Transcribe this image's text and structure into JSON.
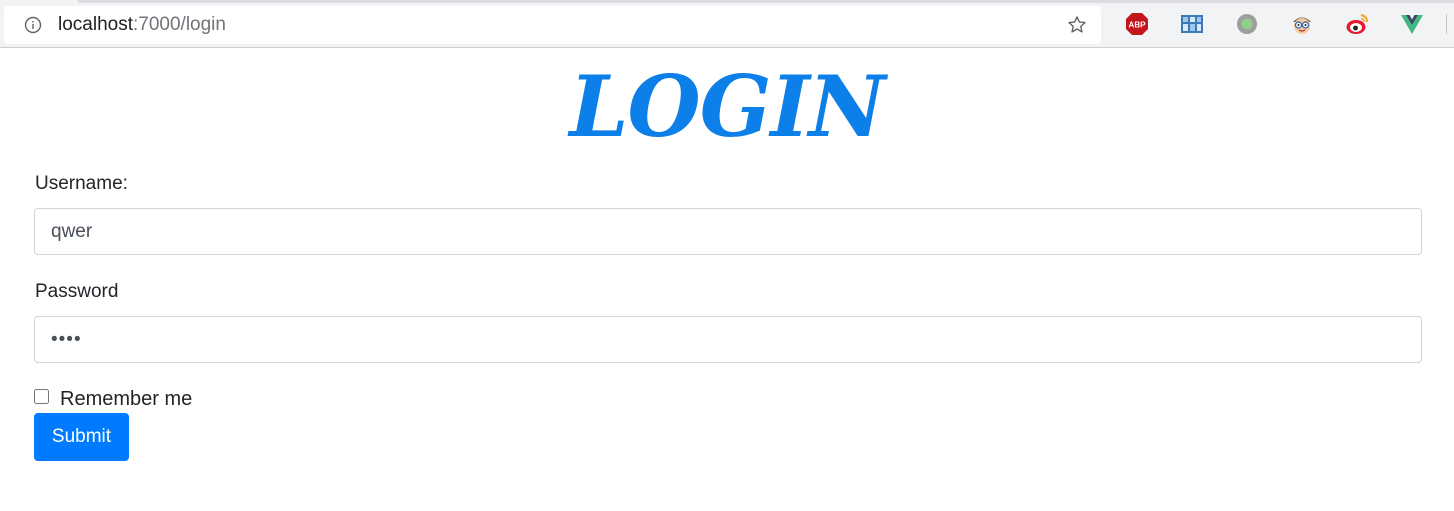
{
  "browser": {
    "url_host": "localhost",
    "url_path": ":7000/login",
    "extensions": [
      {
        "name": "adblock-plus-icon",
        "label": "ABP"
      },
      {
        "name": "grid-extension-icon"
      },
      {
        "name": "green-dot-extension-icon"
      },
      {
        "name": "spy-face-extension-icon"
      },
      {
        "name": "weibo-extension-icon"
      },
      {
        "name": "vue-devtools-icon"
      }
    ]
  },
  "page": {
    "title": "LOGIN",
    "title_color": "#0d7fe8"
  },
  "form": {
    "username_label": "Username:",
    "username_value": "qwer",
    "password_label": "Password",
    "password_value": "••••",
    "remember_label": "Remember me",
    "remember_checked": false,
    "submit_label": "Submit",
    "submit_color": "#007bff"
  }
}
